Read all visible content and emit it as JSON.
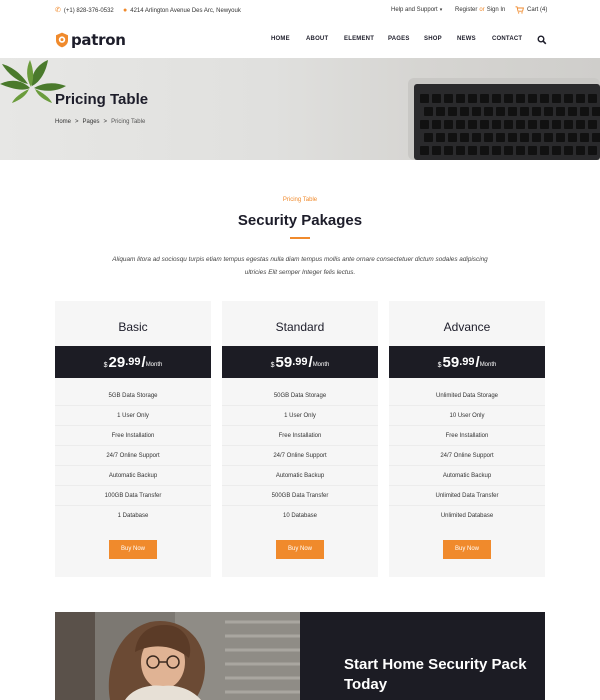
{
  "topbar": {
    "phone": "(+1) 828-376-0532",
    "address": "4214 Arlington Avenue Des Arc, Newyouk",
    "help": "Help and Support",
    "register": "Register",
    "or": "or",
    "signin": "Sign In",
    "cart": "Cart (4)"
  },
  "brand": {
    "name": "patron",
    "accent": "#f08a2c",
    "dark": "#1c1c24"
  },
  "nav": {
    "items": [
      "HOME",
      "ABOUT",
      "ELEMENT",
      "PAGES",
      "SHOP",
      "NEWS",
      "CONTACT"
    ]
  },
  "hero": {
    "title": "Pricing Table",
    "breadcrumb": [
      "Home",
      ">",
      "Pages",
      ">",
      "Pricing Table"
    ]
  },
  "section": {
    "eyebrow": "Pricing Table",
    "title": "Security Pakages",
    "description": "Aliquam litora ad sociosqu turpis etiam tempus egestas nulla diam tempus mollis ante ornare consectetuer dictum sodales adipiscing ultricies Elit semper Integer felis lectus."
  },
  "plans": [
    {
      "name": "Basic",
      "currency": "$",
      "amount": "29",
      "decimals": ".99",
      "slash": "/",
      "period": "Month",
      "features": [
        "5GB Data Storage",
        "1 User Only",
        "Free Installation",
        "24/7 Online Support",
        "Automatic Backup",
        "100GB Data Transfer",
        "1 Database"
      ],
      "button": "Buy Now"
    },
    {
      "name": "Standard",
      "currency": "$",
      "amount": "59",
      "decimals": ".99",
      "slash": "/",
      "period": "Month",
      "features": [
        "50GB Data Storage",
        "1 User Only",
        "Free Installation",
        "24/7 Online Support",
        "Automatic Backup",
        "500GB Data Transfer",
        "10 Database"
      ],
      "button": "Buy Now"
    },
    {
      "name": "Advance",
      "currency": "$",
      "amount": "59",
      "decimals": ".99",
      "slash": "/",
      "period": "Month",
      "features": [
        "Unlimited Data Storage",
        "10 User Only",
        "Free Installation",
        "24/7 Online Support",
        "Automatic Backup",
        "Unlimited Data Transfer",
        "Unlimited Database"
      ],
      "button": "Buy Now"
    }
  ],
  "banner": {
    "title": "Start Home Security Pack Today"
  },
  "icons": {
    "phone": "phone-icon",
    "location": "location-pin-icon",
    "dropdown": "chevron-down-icon",
    "cart": "cart-icon",
    "search": "search-icon"
  }
}
